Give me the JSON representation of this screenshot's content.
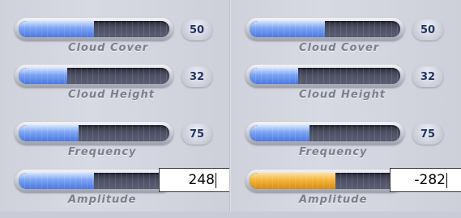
{
  "panels": [
    {
      "sliders": [
        {
          "label": "Cloud Cover",
          "value": "50",
          "level": 0.5
        },
        {
          "label": "Cloud Height",
          "value": "32",
          "level": 0.32
        },
        {
          "label": "Frequency",
          "value": "75",
          "level": 0.4
        },
        {
          "label": "Amplitude",
          "value": "248",
          "level": 0.5,
          "editing": true
        }
      ]
    },
    {
      "sliders": [
        {
          "label": "Cloud Cover",
          "value": "50",
          "level": 0.5
        },
        {
          "label": "Cloud Height",
          "value": "32",
          "level": 0.32
        },
        {
          "label": "Frequency",
          "value": "75",
          "level": 0.4
        },
        {
          "label": "Amplitude",
          "value": "-282",
          "level": 0.57,
          "editing": true,
          "fill_color": "orange"
        }
      ]
    }
  ],
  "colors": {
    "blue_fill": "#7aa2f2",
    "orange_fill": "#f3b43a",
    "badge_text": "#223366",
    "label_text": "#7c808c"
  }
}
